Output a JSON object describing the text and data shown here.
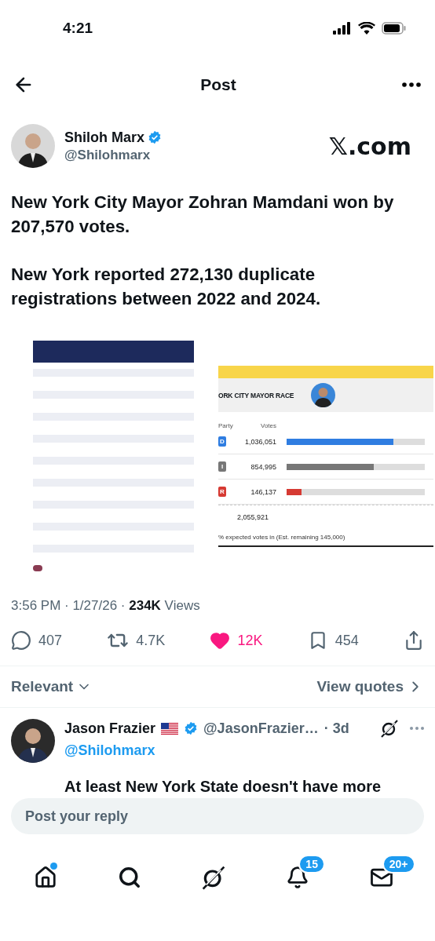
{
  "status_bar": {
    "time": "4:21"
  },
  "header": {
    "title": "Post"
  },
  "author": {
    "name": "Shiloh Marx",
    "handle": "@Shilohmarx",
    "verified": true
  },
  "site_label": "𝕏.com",
  "text": [
    "New York City Mayor Zohran Mamdani won by 207,570 votes.",
    "New York reported 272,130 duplicate registrations between 2022 and 2024."
  ],
  "media": [
    {
      "kind": "picture"
    },
    {
      "kind": "results",
      "title": "ORK CITY MAYOR RACE",
      "columns": [
        "Party",
        "Votes"
      ],
      "rows": [
        {
          "party": "D",
          "votes": "1,036,051",
          "level": 0.77,
          "color": "#2f7de1"
        },
        {
          "party": "I",
          "votes": "854,995",
          "level": 0.63,
          "color": "#777777"
        },
        {
          "party": "R",
          "votes": "146,137",
          "level": 0.11,
          "color": "#d63a33"
        }
      ],
      "total": "2,055,921",
      "note": "% expected votes in (Est. remaining 145,000)"
    }
  ],
  "meta": "3:56 PM · 1/27/26 · **234K** Views",
  "actions": [
    {
      "kind": "reply",
      "count": "407",
      "active": false
    },
    {
      "kind": "repost",
      "count": "4.7K",
      "active": false
    },
    {
      "kind": "like",
      "count": "12K",
      "active": true
    },
    {
      "kind": "bookmark",
      "count": "454",
      "active": false
    },
    {
      "kind": "share",
      "active": false
    }
  ],
  "sort": {
    "label": "Relevant"
  },
  "quotes_link": "View quotes",
  "reply": {
    "name": "Jason Frazier",
    "verified": true,
    "handle": "@JasonFrazier…",
    "age": "· 3d",
    "replying_to": "@Shilohmarx",
    "text": "At least New York State doesn't have more"
  },
  "reply_field": {
    "placeholder": "Post your reply"
  },
  "nav": [
    {
      "kind": "home",
      "dot": true
    },
    {
      "kind": "search",
      "dot": false
    },
    {
      "kind": "grok",
      "dot": false
    },
    {
      "kind": "notifications",
      "dot": false,
      "badge": "15"
    },
    {
      "kind": "messages",
      "dot": false,
      "badge": "20+"
    }
  ]
}
